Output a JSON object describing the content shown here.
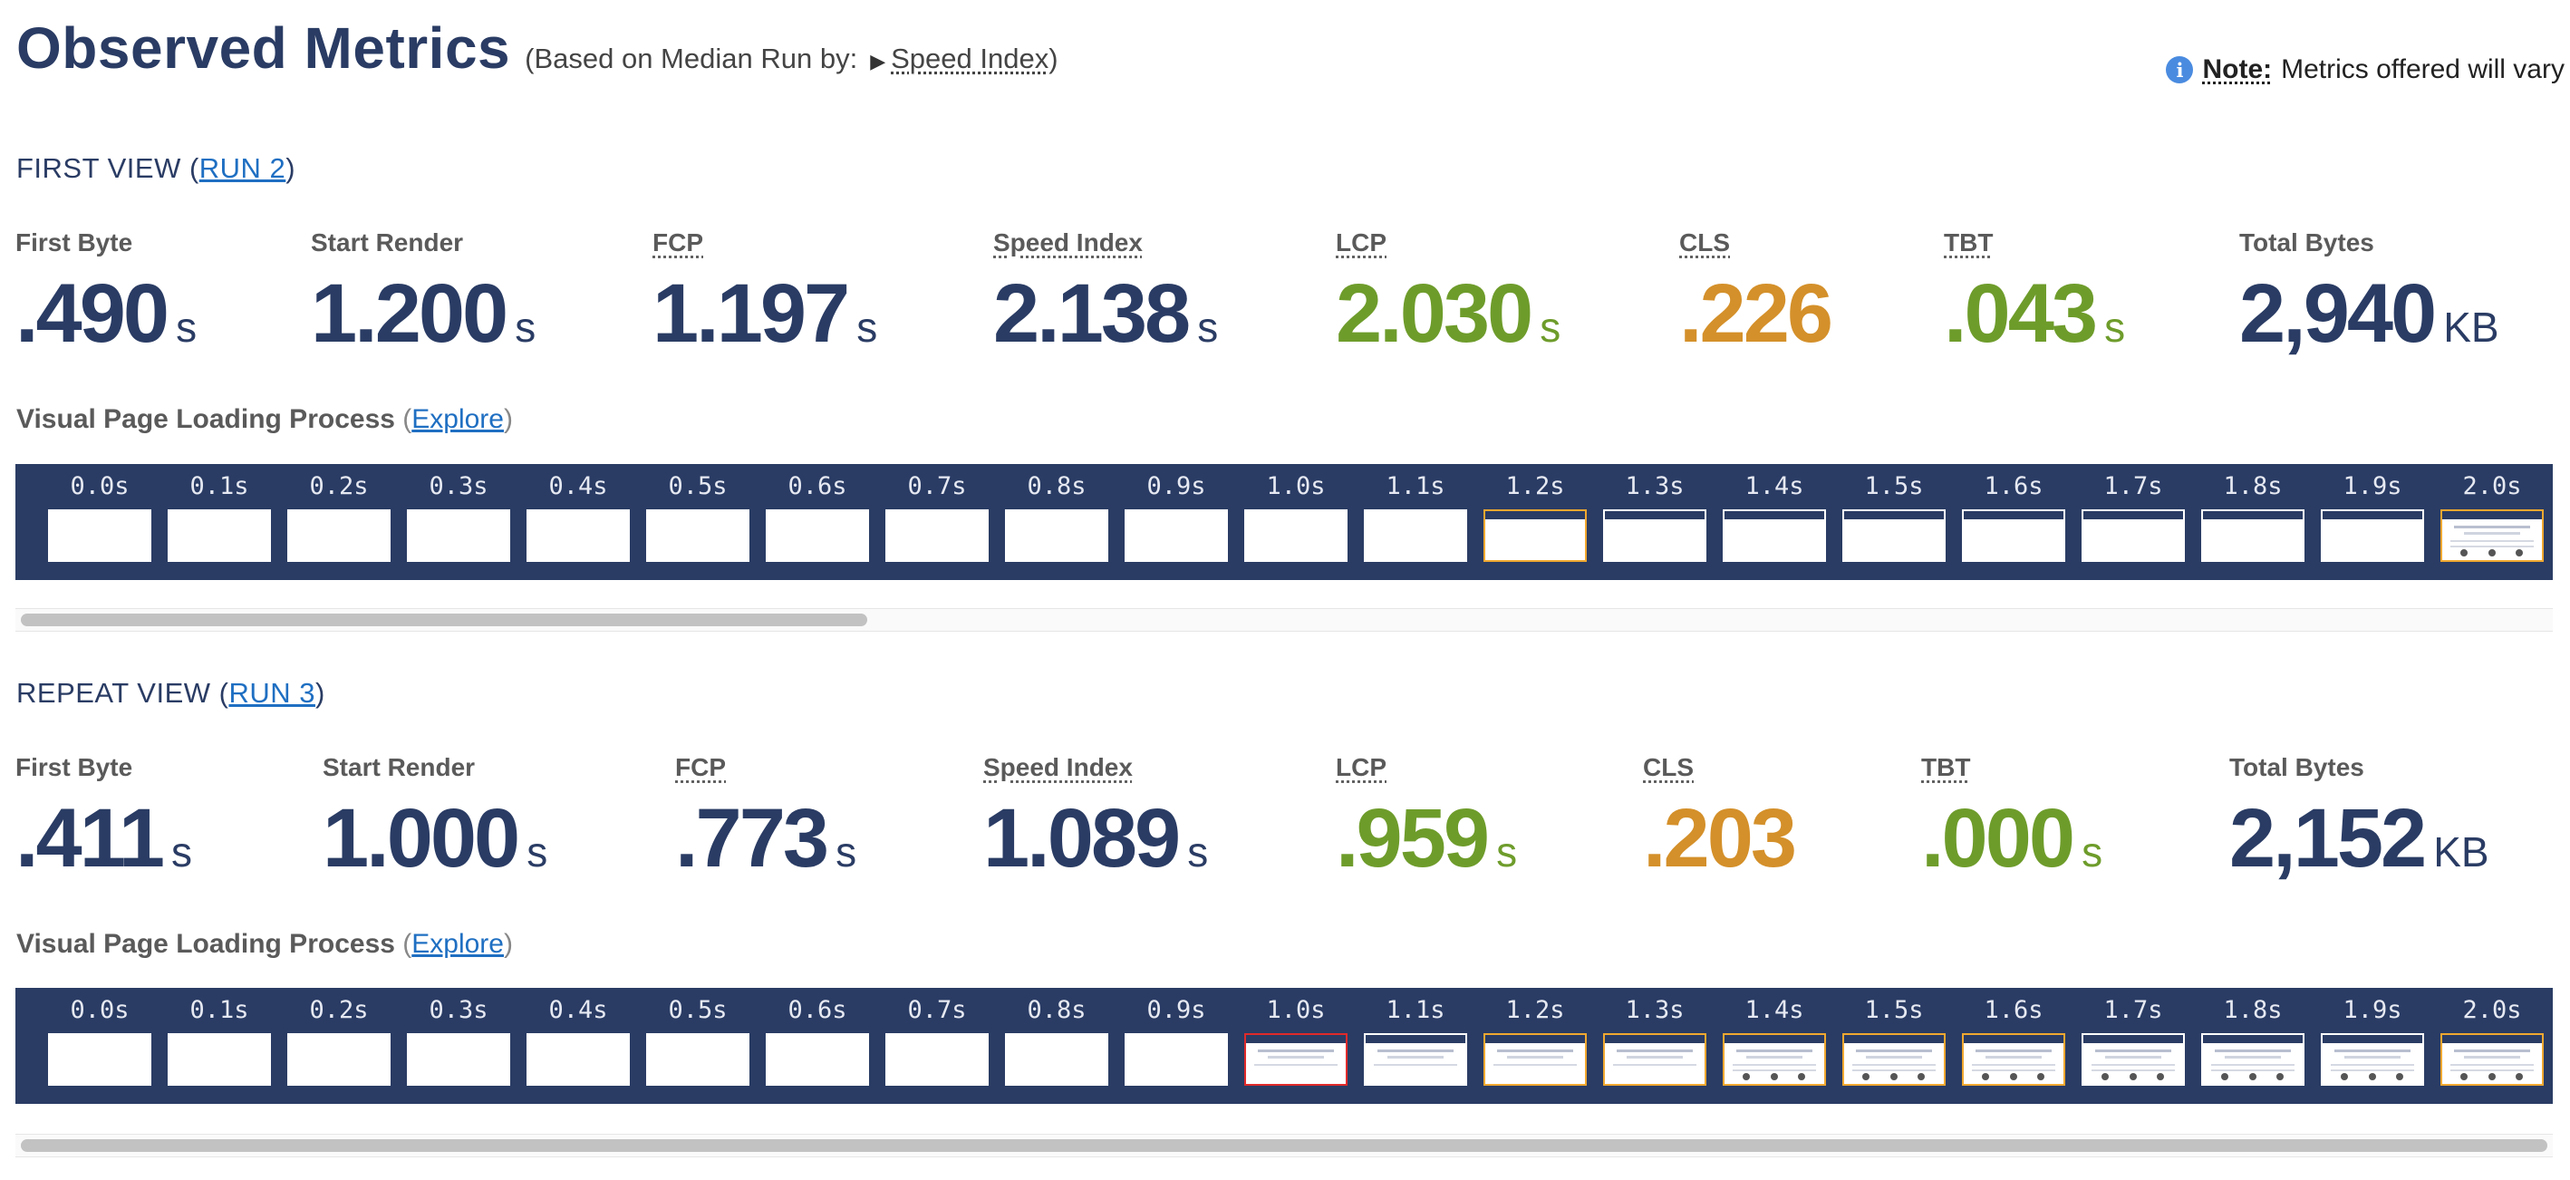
{
  "header": {
    "title": "Observed Metrics",
    "based_prefix": "(Based on Median Run by:",
    "based_metric": "Speed Index",
    "based_suffix": ")",
    "note_label": "Note:",
    "note_text": "Metrics offered will vary"
  },
  "views": [
    {
      "key": "first",
      "title_prefix": "FIRST VIEW (",
      "run_link": "RUN 2",
      "title_suffix": ")",
      "metrics": [
        {
          "label": "First Byte",
          "value": ".490",
          "unit": "s",
          "color": "navy",
          "dotted": false
        },
        {
          "label": "Start Render",
          "value": "1.200",
          "unit": "s",
          "color": "navy",
          "dotted": false
        },
        {
          "label": "FCP",
          "value": "1.197",
          "unit": "s",
          "color": "navy",
          "dotted": true
        },
        {
          "label": "Speed Index",
          "value": "2.138",
          "unit": "s",
          "color": "navy",
          "dotted": true
        },
        {
          "label": "LCP",
          "value": "2.030",
          "unit": "s",
          "color": "green",
          "dotted": true
        },
        {
          "label": "CLS",
          "value": ".226",
          "unit": "",
          "color": "orange",
          "dotted": true
        },
        {
          "label": "TBT",
          "value": ".043",
          "unit": "s",
          "color": "green",
          "dotted": true
        },
        {
          "label": "Total Bytes",
          "value": "2,940",
          "unit": "KB",
          "color": "navy",
          "dotted": false
        }
      ],
      "visual_label": "Visual Page Loading Process",
      "explore_label": "Explore",
      "frames": [
        {
          "time": "0.0s",
          "state": "blank"
        },
        {
          "time": "0.1s",
          "state": "blank"
        },
        {
          "time": "0.2s",
          "state": "blank"
        },
        {
          "time": "0.3s",
          "state": "blank"
        },
        {
          "time": "0.4s",
          "state": "blank"
        },
        {
          "time": "0.5s",
          "state": "blank"
        },
        {
          "time": "0.6s",
          "state": "blank"
        },
        {
          "time": "0.7s",
          "state": "blank"
        },
        {
          "time": "0.8s",
          "state": "blank"
        },
        {
          "time": "0.9s",
          "state": "blank"
        },
        {
          "time": "1.0s",
          "state": "blank"
        },
        {
          "time": "1.1s",
          "state": "blank"
        },
        {
          "time": "1.2s",
          "state": "header",
          "highlight": "orange"
        },
        {
          "time": "1.3s",
          "state": "header"
        },
        {
          "time": "1.4s",
          "state": "header"
        },
        {
          "time": "1.5s",
          "state": "header"
        },
        {
          "time": "1.6s",
          "state": "header"
        },
        {
          "time": "1.7s",
          "state": "header"
        },
        {
          "time": "1.8s",
          "state": "header"
        },
        {
          "time": "1.9s",
          "state": "header"
        },
        {
          "time": "2.0s",
          "state": "full",
          "highlight": "orange"
        }
      ],
      "scroll_fraction": 0.335
    },
    {
      "key": "repeat",
      "title_prefix": "REPEAT VIEW (",
      "run_link": "RUN 3",
      "title_suffix": ")",
      "metrics": [
        {
          "label": "First Byte",
          "value": ".411",
          "unit": "s",
          "color": "navy",
          "dotted": false
        },
        {
          "label": "Start Render",
          "value": "1.000",
          "unit": "s",
          "color": "navy",
          "dotted": false
        },
        {
          "label": "FCP",
          "value": ".773",
          "unit": "s",
          "color": "navy",
          "dotted": true
        },
        {
          "label": "Speed Index",
          "value": "1.089",
          "unit": "s",
          "color": "navy",
          "dotted": true
        },
        {
          "label": "LCP",
          "value": ".959",
          "unit": "s",
          "color": "green",
          "dotted": true
        },
        {
          "label": "CLS",
          "value": ".203",
          "unit": "",
          "color": "orange",
          "dotted": true
        },
        {
          "label": "TBT",
          "value": ".000",
          "unit": "s",
          "color": "green",
          "dotted": true
        },
        {
          "label": "Total Bytes",
          "value": "2,152",
          "unit": "KB",
          "color": "navy",
          "dotted": false
        }
      ],
      "visual_label": "Visual Page Loading Process",
      "explore_label": "Explore",
      "frames": [
        {
          "time": "0.0s",
          "state": "blank"
        },
        {
          "time": "0.1s",
          "state": "blank"
        },
        {
          "time": "0.2s",
          "state": "blank"
        },
        {
          "time": "0.3s",
          "state": "blank"
        },
        {
          "time": "0.4s",
          "state": "blank"
        },
        {
          "time": "0.5s",
          "state": "blank"
        },
        {
          "time": "0.6s",
          "state": "blank"
        },
        {
          "time": "0.7s",
          "state": "blank"
        },
        {
          "time": "0.8s",
          "state": "blank"
        },
        {
          "time": "0.9s",
          "state": "blank"
        },
        {
          "time": "1.0s",
          "state": "content",
          "highlight": "red"
        },
        {
          "time": "1.1s",
          "state": "content"
        },
        {
          "time": "1.2s",
          "state": "content",
          "highlight": "orange"
        },
        {
          "time": "1.3s",
          "state": "content",
          "highlight": "orange"
        },
        {
          "time": "1.4s",
          "state": "full",
          "highlight": "orange"
        },
        {
          "time": "1.5s",
          "state": "full",
          "highlight": "orange"
        },
        {
          "time": "1.6s",
          "state": "full",
          "highlight": "orange"
        },
        {
          "time": "1.7s",
          "state": "full"
        },
        {
          "time": "1.8s",
          "state": "full"
        },
        {
          "time": "1.9s",
          "state": "full"
        },
        {
          "time": "2.0s",
          "state": "full",
          "highlight": "orange"
        }
      ],
      "scroll_fraction": 1.0
    }
  ]
}
